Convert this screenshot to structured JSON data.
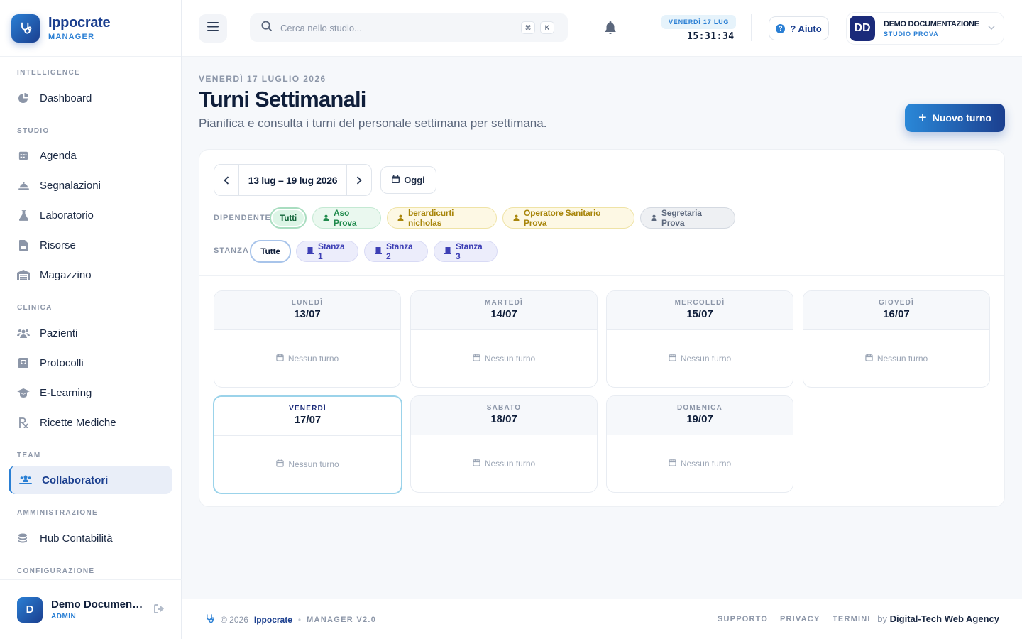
{
  "brand": {
    "name": "Ippocrate",
    "sub": "MANAGER"
  },
  "sidebar": {
    "sections": [
      {
        "label": "INTELLIGENCE"
      },
      {
        "label": "STUDIO"
      },
      {
        "label": "CLINICA"
      },
      {
        "label": "TEAM"
      },
      {
        "label": "AMMINISTRAZIONE"
      },
      {
        "label": "CONFIGURAZIONE"
      }
    ],
    "items": [
      {
        "label": "Dashboard",
        "icon": "pie-chart-icon"
      },
      {
        "label": "Agenda",
        "icon": "calendar-grid-icon"
      },
      {
        "label": "Segnalazioni",
        "icon": "bell-desk-icon"
      },
      {
        "label": "Laboratorio",
        "icon": "flask-icon"
      },
      {
        "label": "Risorse",
        "icon": "folder-icon"
      },
      {
        "label": "Magazzino",
        "icon": "warehouse-icon"
      },
      {
        "label": "Pazienti",
        "icon": "users-icon"
      },
      {
        "label": "Protocolli",
        "icon": "clipboard-icon"
      },
      {
        "label": "E-Learning",
        "icon": "graduation-cap-icon"
      },
      {
        "label": "Ricette Mediche",
        "icon": "prescription-icon"
      },
      {
        "label": "Collaboratori",
        "icon": "team-icon",
        "active": true
      },
      {
        "label": "Hub Contabilità",
        "icon": "coins-icon"
      }
    ],
    "user": {
      "initial": "D",
      "name": "Demo Documentazione",
      "role": "ADMIN"
    }
  },
  "header": {
    "search_placeholder": "Cerca nello studio...",
    "kbd1": "⌘",
    "kbd2": "K",
    "date_badge": "VENERDÌ 17 LUG",
    "clock": "15:31:34",
    "help_label": "? Aiuto",
    "user": {
      "initials": "DD",
      "name": "DEMO DOCUMENTAZIONE",
      "sub": "STUDIO PROVA"
    }
  },
  "page": {
    "kicker": "VENERDÌ 17 LUGLIO 2026",
    "title": "Turni Settimanali",
    "subtitle": "Pianifica e consulta i turni del personale settimana per settimana.",
    "new_button": "Nuovo turno"
  },
  "week": {
    "range": "13 lug – 19 lug 2026",
    "today_label": "Oggi"
  },
  "filters": {
    "employee_label": "DIPENDENTE",
    "employees": [
      {
        "label": "Tutti",
        "selected": true
      },
      {
        "label": "Aso Prova"
      },
      {
        "label": "berardicurti nicholas"
      },
      {
        "label": "Operatore Sanitario Prova"
      },
      {
        "label": "Segretaria Prova"
      }
    ],
    "room_label": "STANZA",
    "rooms": [
      {
        "label": "Tutte",
        "selected": true
      },
      {
        "label": "Stanza 1"
      },
      {
        "label": "Stanza 2"
      },
      {
        "label": "Stanza 3"
      }
    ]
  },
  "days": [
    {
      "name": "LUNEDÌ",
      "date": "13/07",
      "empty": "Nessun turno"
    },
    {
      "name": "MARTEDÌ",
      "date": "14/07",
      "empty": "Nessun turno"
    },
    {
      "name": "MERCOLEDÌ",
      "date": "15/07",
      "empty": "Nessun turno"
    },
    {
      "name": "GIOVEDÌ",
      "date": "16/07",
      "empty": "Nessun turno"
    },
    {
      "name": "VENERDÌ",
      "date": "17/07",
      "empty": "Nessun turno",
      "today": true
    },
    {
      "name": "SABATO",
      "date": "18/07",
      "empty": "Nessun turno"
    },
    {
      "name": "DOMENICA",
      "date": "19/07",
      "empty": "Nessun turno"
    }
  ],
  "footer": {
    "copyright": "© 2026",
    "brand": "Ippocrate",
    "version": "MANAGER V2.0",
    "links": [
      "SUPPORTO",
      "PRIVACY",
      "TERMINI"
    ],
    "by": "by",
    "agency": "Digital-Tech Web Agency"
  },
  "colors": {
    "accent": "#2a7fd4",
    "brand_dark": "#1b3f8f",
    "text": "#0f1e3a",
    "muted": "#8c96a8"
  }
}
